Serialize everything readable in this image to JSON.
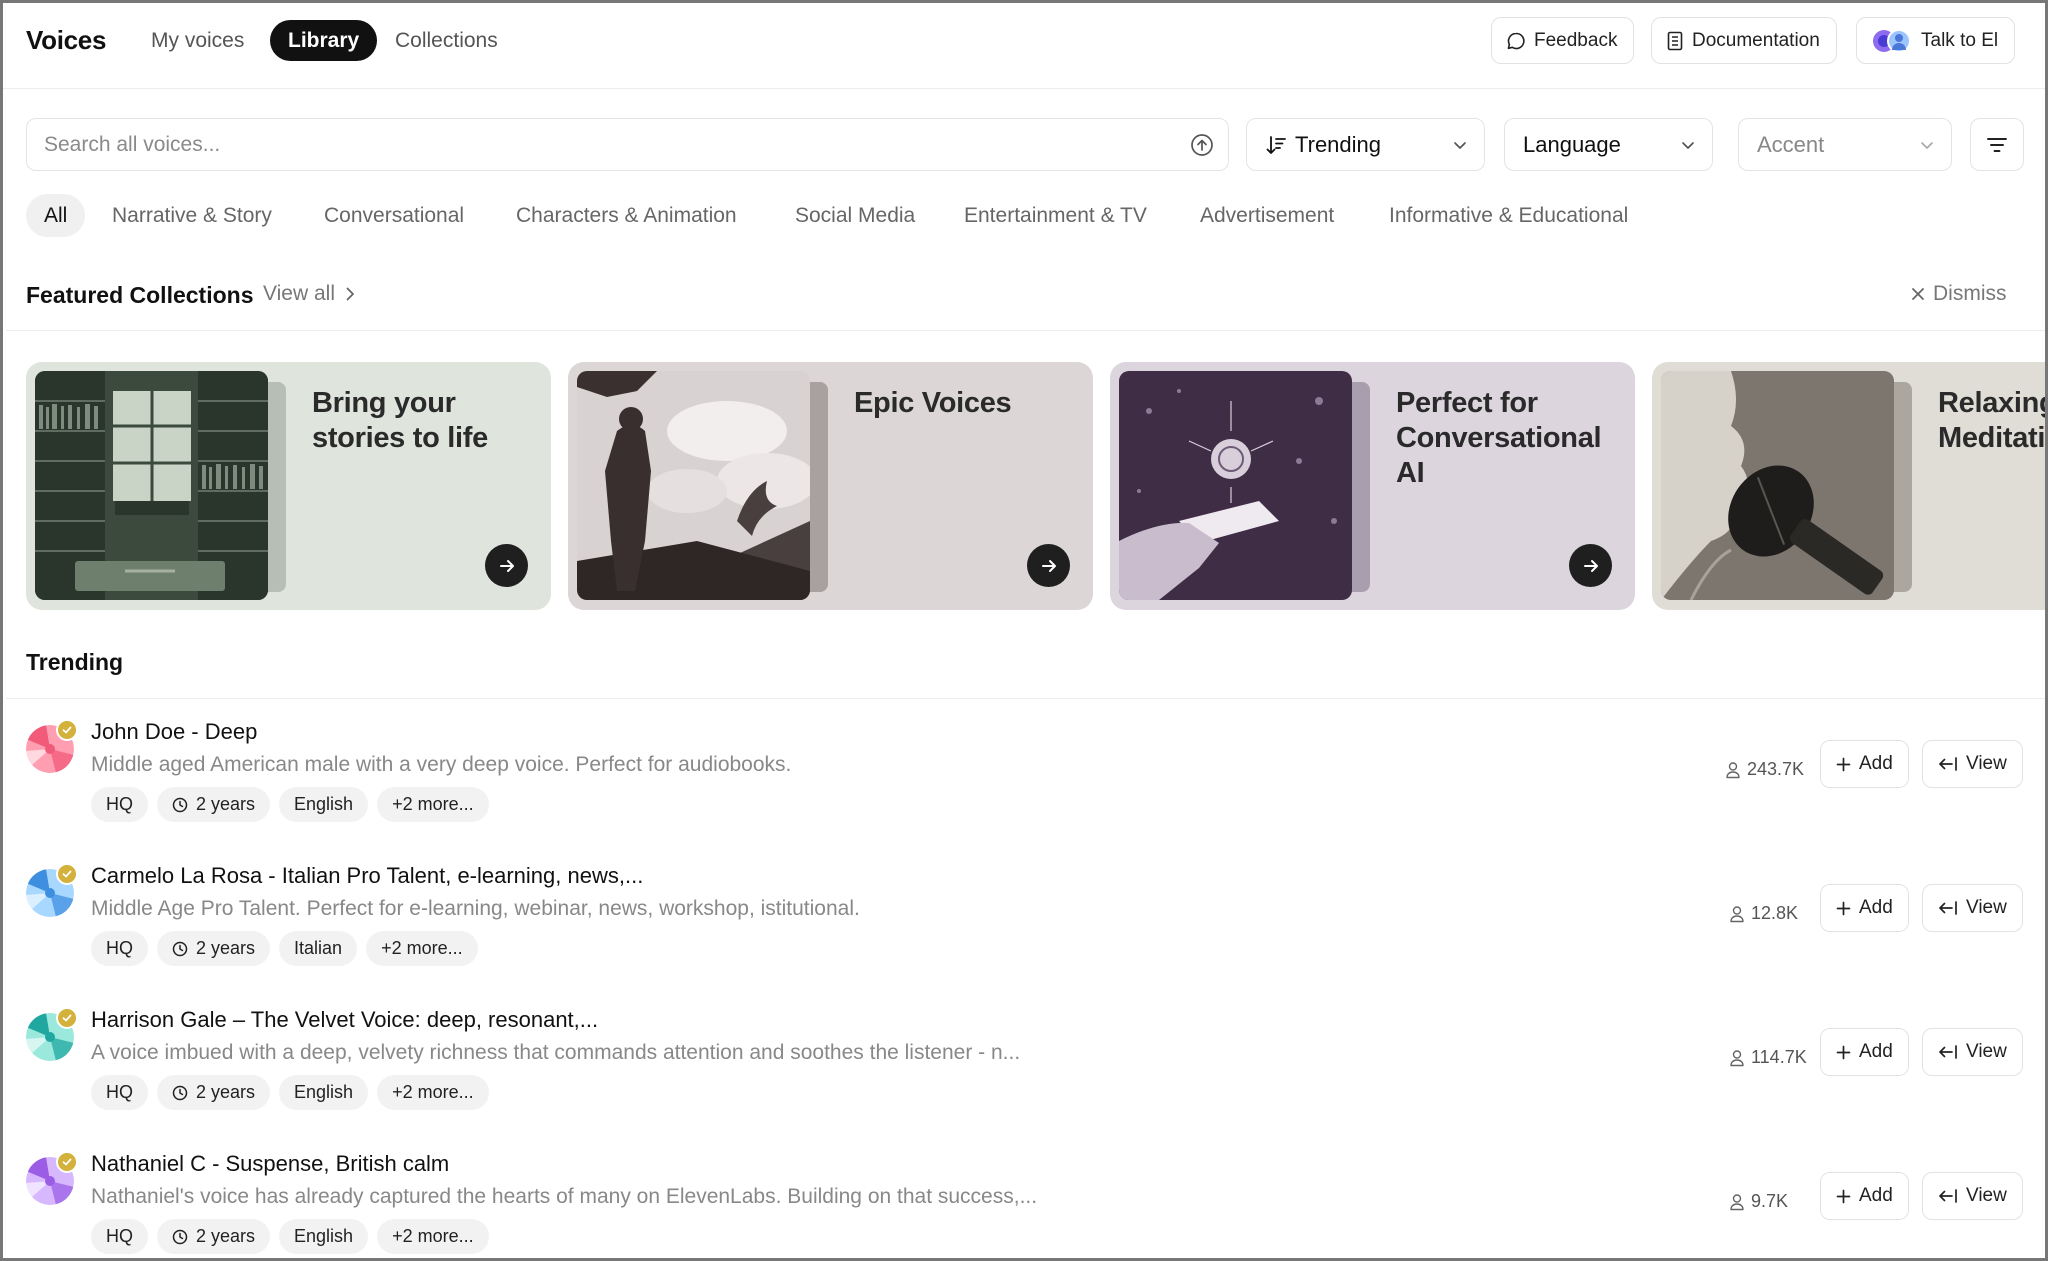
{
  "header": {
    "title": "Voices",
    "tabs": [
      {
        "label": "My voices"
      },
      {
        "label": "Library"
      },
      {
        "label": "Collections"
      }
    ],
    "feedback_label": "Feedback",
    "documentation_label": "Documentation",
    "talk_label": "Talk to El"
  },
  "filters": {
    "search_placeholder": "Search all voices...",
    "sort_value": "Trending",
    "language_value": "Language",
    "accent_value": "Accent"
  },
  "categories": [
    {
      "label": "All"
    },
    {
      "label": "Narrative & Story"
    },
    {
      "label": "Conversational"
    },
    {
      "label": "Characters & Animation"
    },
    {
      "label": "Social Media"
    },
    {
      "label": "Entertainment & TV"
    },
    {
      "label": "Advertisement"
    },
    {
      "label": "Informative & Educational"
    }
  ],
  "featured": {
    "title": "Featured Collections",
    "view_all": "View all",
    "dismiss": "Dismiss",
    "cards": [
      {
        "title": "Bring your stories to life",
        "bg": "#dfe4dd",
        "tab": "#b6beb5"
      },
      {
        "title": "Epic Voices",
        "bg": "#ddd6d6",
        "tab": "#a9a0a0"
      },
      {
        "title": "Perfect for Conversational AI",
        "bg": "#dcd5de",
        "tab": "#a99ead"
      },
      {
        "title": "Relaxing Meditation",
        "bg": "#e0ddd7",
        "tab": "#aba79f"
      }
    ]
  },
  "trending": {
    "title": "Trending",
    "voices": [
      {
        "name": "John Doe - Deep",
        "description": "Middle aged American male with a very deep voice. Perfect for audiobooks.",
        "tags": [
          "HQ",
          "2 years",
          "English",
          "+2 more..."
        ],
        "uses": "243.7K",
        "add": "Add",
        "view": "View",
        "avatar_colors": [
          "#f25a7a",
          "#ff9eb1"
        ]
      },
      {
        "name": "Carmelo La Rosa - Italian Pro Talent, e-learning, news,...",
        "description": "Middle Age Pro Talent. Perfect for e-learning, webinar, news, workshop, istitutional.",
        "tags": [
          "HQ",
          "2 years",
          "Italian",
          "+2 more..."
        ],
        "uses": "12.8K",
        "add": "Add",
        "view": "View",
        "avatar_colors": [
          "#3f8fe0",
          "#a8d8ff"
        ]
      },
      {
        "name": "Harrison Gale – The Velvet Voice: deep, resonant,...",
        "description": "A voice imbued with a deep, velvety richness that commands attention and soothes the listener - n...",
        "tags": [
          "HQ",
          "2 years",
          "English",
          "+2 more..."
        ],
        "uses": "114.7K",
        "add": "Add",
        "view": "View",
        "avatar_colors": [
          "#20a8a0",
          "#9be8dc"
        ]
      },
      {
        "name": "Nathaniel C - Suspense, British calm",
        "description": "Nathaniel's voice has already captured the hearts of many on ElevenLabs. Building on that success,...",
        "tags": [
          "HQ",
          "2 years",
          "English",
          "+2 more..."
        ],
        "uses": "9.7K",
        "add": "Add",
        "view": "View",
        "avatar_colors": [
          "#9b5de5",
          "#d7b8ff"
        ]
      }
    ]
  }
}
